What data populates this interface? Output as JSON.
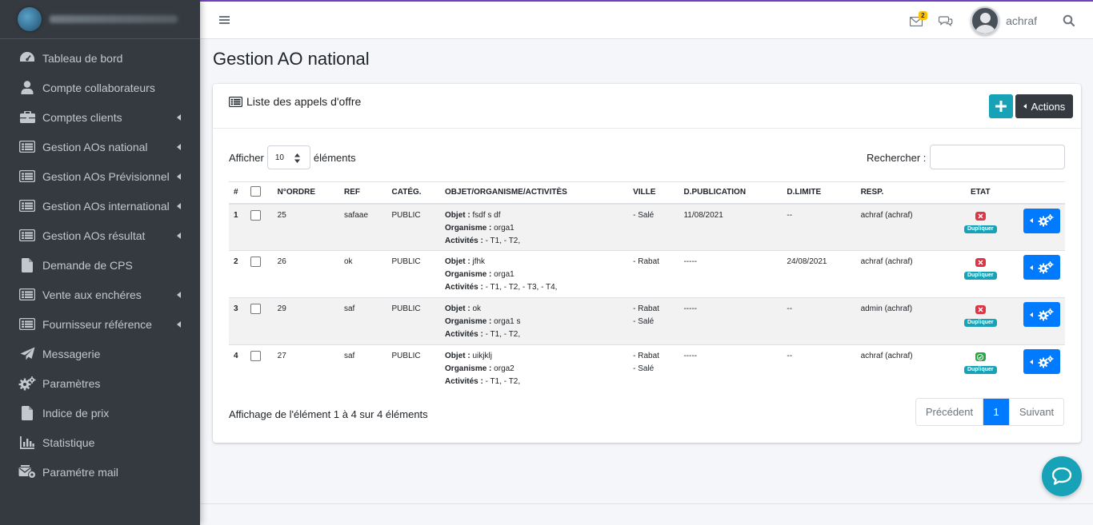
{
  "sidebar": {
    "items": [
      {
        "label": "Tableau de bord",
        "icon": "dashboard-icon",
        "has_arrow": false
      },
      {
        "label": "Compte collaborateurs",
        "icon": "user-icon",
        "has_arrow": false
      },
      {
        "label": "Comptes clients",
        "icon": "briefcase-icon",
        "has_arrow": true
      },
      {
        "label": "Gestion AOs national",
        "icon": "list-icon",
        "has_arrow": true
      },
      {
        "label": "Gestion AOs Prévisionnel",
        "icon": "list-icon",
        "has_arrow": true
      },
      {
        "label": "Gestion AOs international",
        "icon": "list-icon",
        "has_arrow": true
      },
      {
        "label": "Gestion AOs résultat",
        "icon": "list-icon",
        "has_arrow": true
      },
      {
        "label": "Demande de CPS",
        "icon": "file-icon",
        "has_arrow": false
      },
      {
        "label": "Vente aux enchéres",
        "icon": "list-icon",
        "has_arrow": true
      },
      {
        "label": "Fournisseur référence",
        "icon": "list-icon",
        "has_arrow": true
      },
      {
        "label": "Messagerie",
        "icon": "paper-plane-icon",
        "has_arrow": false
      },
      {
        "label": "Paramètres",
        "icon": "cogs-icon",
        "has_arrow": false
      },
      {
        "label": "Indice de prix",
        "icon": "file-icon",
        "has_arrow": false
      },
      {
        "label": "Statistique",
        "icon": "bar-chart-icon",
        "has_arrow": false
      },
      {
        "label": "Paramétre mail",
        "icon": "mail-settings-icon",
        "has_arrow": false
      }
    ]
  },
  "header": {
    "mail_badge": "2",
    "username": "achraf"
  },
  "page": {
    "title": "Gestion AO national"
  },
  "card": {
    "title": "Liste des appels d'offre",
    "actions_label": "Actions",
    "show_prefix": "Afficher",
    "show_value": "10",
    "show_suffix": "éléments",
    "search_label": "Rechercher :",
    "search_value": ""
  },
  "table": {
    "columns": [
      "#",
      "",
      "N°ORDRE",
      "REF",
      "CATÉG.",
      "OBJET/ORGANISME/ACTIVITÈS",
      "VILLE",
      "D.PUBLICATION",
      "D.LIMITE",
      "RESP.",
      "ETAT",
      ""
    ],
    "obj_label": "Objet :",
    "org_label": "Organisme :",
    "act_label": "Activités :",
    "dup_label": "Dupliquer",
    "rows": [
      {
        "num": "1",
        "ordre": "25",
        "ref": "safaae",
        "categ": "PUBLIC",
        "objet": "fsdf s df",
        "organisme": "orga1",
        "activites": "- T1, - T2,",
        "ville1": "- Salé",
        "ville2": "",
        "d_pub": "11/08/2021",
        "d_lim": "--",
        "resp": "achraf (achraf)",
        "etat": "x"
      },
      {
        "num": "2",
        "ordre": "26",
        "ref": "ok",
        "categ": "PUBLIC",
        "objet": "jfhk",
        "organisme": "orga1",
        "activites": "- T1, - T2, - T3, - T4,",
        "ville1": "- Rabat",
        "ville2": "",
        "d_pub": "-----",
        "d_lim": "24/08/2021",
        "resp": "achraf (achraf)",
        "etat": "x"
      },
      {
        "num": "3",
        "ordre": "29",
        "ref": "saf",
        "categ": "PUBLIC",
        "objet": "ok",
        "organisme": "orga1 s",
        "activites": "- T1, - T2,",
        "ville1": "- Rabat",
        "ville2": "- Salé",
        "d_pub": "-----",
        "d_lim": "--",
        "resp": "admin (achraf)",
        "etat": "x"
      },
      {
        "num": "4",
        "ordre": "27",
        "ref": "saf",
        "categ": "PUBLIC",
        "objet": "uikjklj",
        "organisme": "orga2",
        "activites": "- T1, - T2,",
        "ville1": "- Rabat",
        "ville2": "- Salé",
        "d_pub": "-----",
        "d_lim": "--",
        "resp": "achraf (achraf)",
        "etat": "ok"
      }
    ]
  },
  "footer": {
    "info": "Affichage de l'élément 1 à 4 sur 4 éléments",
    "prev": "Précédent",
    "page": "1",
    "next": "Suivant"
  },
  "colors": {
    "sidebar_bg": "#343a40",
    "primary": "#007bff",
    "info": "#17a2b8",
    "danger": "#dc3545",
    "success": "#28a745"
  }
}
